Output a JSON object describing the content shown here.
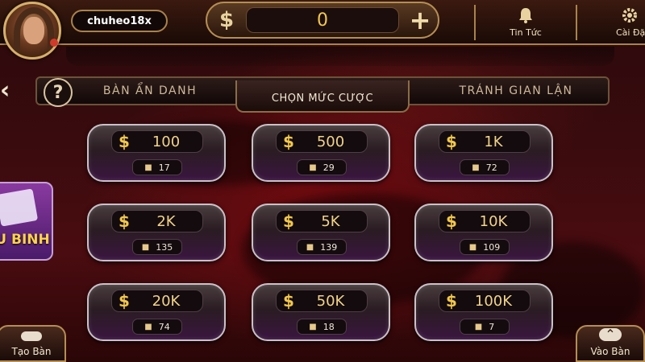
{
  "header": {
    "username": "chuheo18x",
    "currency_symbol": "$",
    "balance": "0",
    "add_symbol": "+",
    "news_label": "Tin Tức",
    "settings_label": "Cài Đặ"
  },
  "tabs": [
    {
      "label": "BÀN ẨN DANH",
      "active": false
    },
    {
      "label": "CHỌN MỨC CƯỢC",
      "active": true
    },
    {
      "label": "TRÁNH GIAN LẬN",
      "active": false
    }
  ],
  "help_symbol": "?",
  "back_symbol": "‹",
  "bets": [
    {
      "amount": "100",
      "players": "17"
    },
    {
      "amount": "500",
      "players": "29"
    },
    {
      "amount": "1K",
      "players": "72"
    },
    {
      "amount": "2K",
      "players": "135"
    },
    {
      "amount": "5K",
      "players": "139"
    },
    {
      "amount": "10K",
      "players": "109"
    },
    {
      "amount": "20K",
      "players": "74"
    },
    {
      "amount": "50K",
      "players": "18"
    },
    {
      "amount": "100K",
      "players": "7"
    }
  ],
  "side_game": {
    "label": "U BINH"
  },
  "bottom": {
    "create_table": "Tạo Bàn",
    "join_table": "Vào Bàn"
  },
  "icons": {
    "bell": "bell-icon",
    "gear": "gear-icon",
    "player": "player-icon"
  },
  "colors": {
    "gold": "#f2c84b",
    "frame": "#a9834a",
    "background": "#3a0b0e"
  }
}
